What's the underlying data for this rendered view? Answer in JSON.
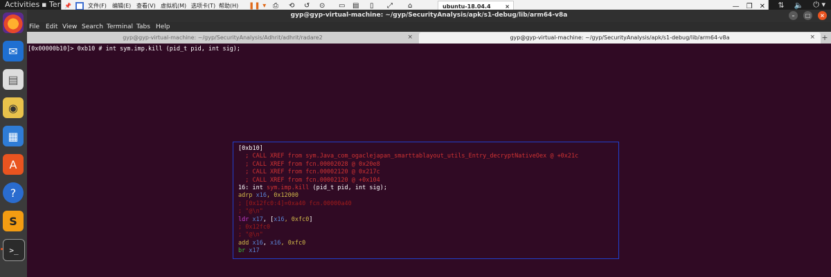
{
  "topbar": {
    "activities": "Activities",
    "app_name": "Ter"
  },
  "vmware": {
    "menu": [
      "文件(F)",
      "编辑(E)",
      "查看(V)",
      "虚拟机(M)",
      "选项卡(T)",
      "帮助(H)"
    ],
    "vm_tab": "ubuntu-18.04.4"
  },
  "window": {
    "title": "gyp@gyp-virtual-machine: ~/gyp/SecurityAnalysis/apk/s1-debug/lib/arm64-v8a",
    "menu": [
      "File",
      "Edit",
      "View",
      "Search",
      "Terminal",
      "Tabs",
      "Help"
    ],
    "tabs": [
      {
        "label": "gyp@gyp-virtual-machine: ~/gyp/SecurityAnalysis/Adhrit/adhrit/radare2",
        "active": false
      },
      {
        "label": "gyp@gyp-virtual-machine: ~/gyp/SecurityAnalysis/apk/s1-debug/lib/arm64-v8a",
        "active": true
      }
    ]
  },
  "terminal": {
    "prompt_line": "[0x00000b10]> 0xb10 # int sym.imp.kill (pid_t pid, int sig);",
    "panel": {
      "header": "[0xb10]",
      "xrefs": [
        "  ; CALL XREF from sym.Java_com_ogaclejapan_smarttablayout_utils_Entry_decryptNativeOex @ +0x21c",
        "  ; CALL XREF from fcn.00002028 @ 0x20e8",
        "  ; CALL XREF from fcn.00002120 @ 0x217c",
        "  ; CALL XREF from fcn.00002120 @ +0x104"
      ],
      "func_prefix": "16: int ",
      "func_name": "sym.imp.kill",
      "func_sig": " (pid_t pid, int sig);",
      "adrp_op": "adrp",
      "adrp_reg": " x16",
      "adrp_rest": ", 0x12000",
      "comment1": "; [0x12fc0:4]=0xa40 fcn.00000a40",
      "comment2": "; \"@\\n\"",
      "ldr_op": "ldr",
      "ldr_reg": " x17",
      "ldr_mid": ", [",
      "ldr_base": "x16",
      "ldr_off": ", 0xfc0",
      "ldr_end": "]",
      "comment3": "; 0x12fc0",
      "comment4": "; \"@\\n\"",
      "add_op": "add",
      "add_reg1": " x16",
      "add_sep": ", ",
      "add_reg2": "x16",
      "add_imm": ", 0xfc0",
      "br_op": "br",
      "br_reg": " x17"
    }
  },
  "colors": {
    "terminal_bg": "#300a24",
    "panel_border": "#2040d0",
    "xref_red": "#d23333",
    "dock_bg": "#3b3b3b",
    "accent": "#e95420"
  }
}
